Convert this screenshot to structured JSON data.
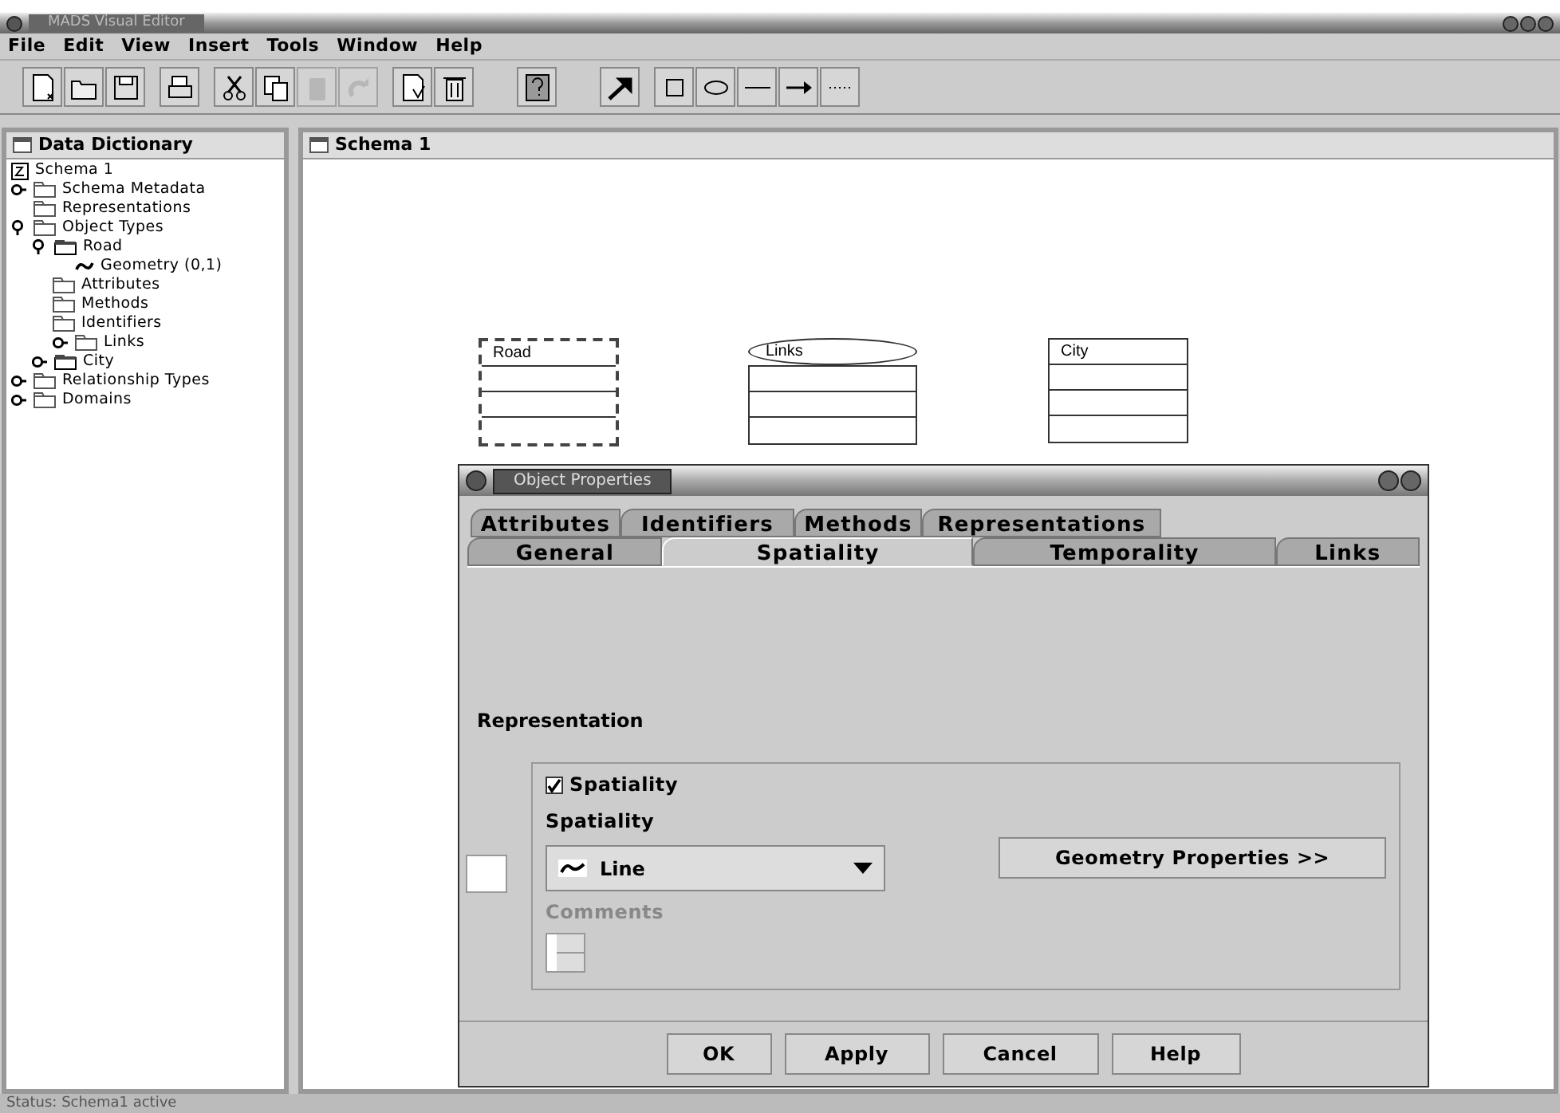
{
  "window": {
    "title": "MADS Visual Editor"
  },
  "menu": [
    "File",
    "Edit",
    "View",
    "Insert",
    "Tools",
    "Window",
    "Help"
  ],
  "toolbar": [
    {
      "kind": "new",
      "disabled": false
    },
    {
      "kind": "open",
      "disabled": false
    },
    {
      "kind": "save",
      "disabled": false
    },
    {
      "kind": "sep"
    },
    {
      "kind": "print",
      "disabled": false
    },
    {
      "kind": "sep"
    },
    {
      "kind": "cut",
      "disabled": false
    },
    {
      "kind": "copy",
      "disabled": false
    },
    {
      "kind": "paste",
      "disabled": true
    },
    {
      "kind": "redo",
      "disabled": true
    },
    {
      "kind": "sep"
    },
    {
      "kind": "export",
      "disabled": false
    },
    {
      "kind": "delete",
      "disabled": false
    },
    {
      "kind": "bigsep"
    },
    {
      "kind": "help",
      "disabled": false
    },
    {
      "kind": "bigsep"
    },
    {
      "kind": "pointer",
      "disabled": false
    },
    {
      "kind": "sep"
    },
    {
      "kind": "rect",
      "disabled": false
    },
    {
      "kind": "oval",
      "disabled": false
    },
    {
      "kind": "line",
      "disabled": false
    },
    {
      "kind": "arrow",
      "disabled": false
    },
    {
      "kind": "dotted",
      "disabled": false
    }
  ],
  "sidebar": {
    "title": "Data Dictionary",
    "tree": [
      {
        "label": "Schema 1",
        "kind": "schema"
      },
      {
        "label": "Schema Metadata",
        "kind": "folder",
        "expanded": false
      },
      {
        "label": "Representations",
        "kind": "folder"
      },
      {
        "label": "Object Types",
        "kind": "folder",
        "expanded": true,
        "children": [
          {
            "label": "Road",
            "kind": "object",
            "expanded": true,
            "children": [
              {
                "label": "Geometry (0,1)",
                "kind": "geometry"
              },
              {
                "label": "Attributes",
                "kind": "folder"
              },
              {
                "label": "Methods",
                "kind": "folder"
              },
              {
                "label": "Identifiers",
                "kind": "folder"
              },
              {
                "label": "Links",
                "kind": "folder",
                "expanded": false
              }
            ]
          },
          {
            "label": "City",
            "kind": "object",
            "expanded": false
          }
        ]
      },
      {
        "label": "Relationship Types",
        "kind": "folder",
        "expanded": false
      },
      {
        "label": "Domains",
        "kind": "folder",
        "expanded": false
      }
    ]
  },
  "canvas": {
    "title": "Schema 1",
    "nodes": [
      {
        "name": "Road",
        "kind": "object",
        "selected": true
      },
      {
        "name": "Links",
        "kind": "relationship",
        "selected": false
      },
      {
        "name": "City",
        "kind": "object",
        "selected": false
      }
    ]
  },
  "dialog": {
    "title": "Object Properties",
    "tab_rows": [
      [
        {
          "label": "Attributes",
          "selected": false
        },
        {
          "label": "Identifiers",
          "selected": false
        },
        {
          "label": "Methods",
          "selected": false
        },
        {
          "label": "Representations",
          "selected": false
        }
      ],
      [
        {
          "label": "General",
          "selected": false
        },
        {
          "label": "Spatiality",
          "selected": true
        },
        {
          "label": "Temporality",
          "selected": false
        },
        {
          "label": "Links",
          "selected": false
        }
      ]
    ],
    "section": "Representation",
    "spatiality_checkbox": {
      "label": "Spatiality",
      "checked": true
    },
    "spatiality_label": "Spatiality",
    "spatiality_select": {
      "value": "Line"
    },
    "geometry_button": "Geometry Properties >>",
    "comments_label": "Comments",
    "comments_disabled": true,
    "buttons": [
      "OK",
      "Apply",
      "Cancel",
      "Help"
    ]
  },
  "status_bar": "Status: Schema1 active"
}
